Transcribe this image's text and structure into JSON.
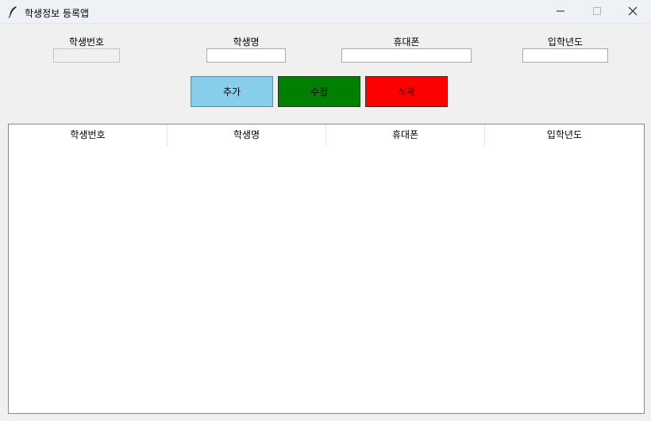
{
  "window": {
    "title": "학생정보 등록앱"
  },
  "form": {
    "student_id": {
      "label": "학생번호",
      "value": ""
    },
    "name": {
      "label": "학생명",
      "value": ""
    },
    "phone": {
      "label": "휴대폰",
      "value": ""
    },
    "year": {
      "label": "입학년도",
      "value": ""
    }
  },
  "buttons": {
    "add": {
      "label": "추가",
      "color": "#87ceeb"
    },
    "edit": {
      "label": "수정",
      "color": "#008000"
    },
    "delete": {
      "label": "삭제",
      "color": "#ff0000"
    }
  },
  "table": {
    "columns": [
      "학생번호",
      "학생명",
      "휴대폰",
      "입학년도"
    ],
    "rows": []
  },
  "icons": {
    "app": "feather-icon",
    "minimize": "minimize-icon",
    "maximize": "maximize-icon",
    "close": "close-icon"
  }
}
